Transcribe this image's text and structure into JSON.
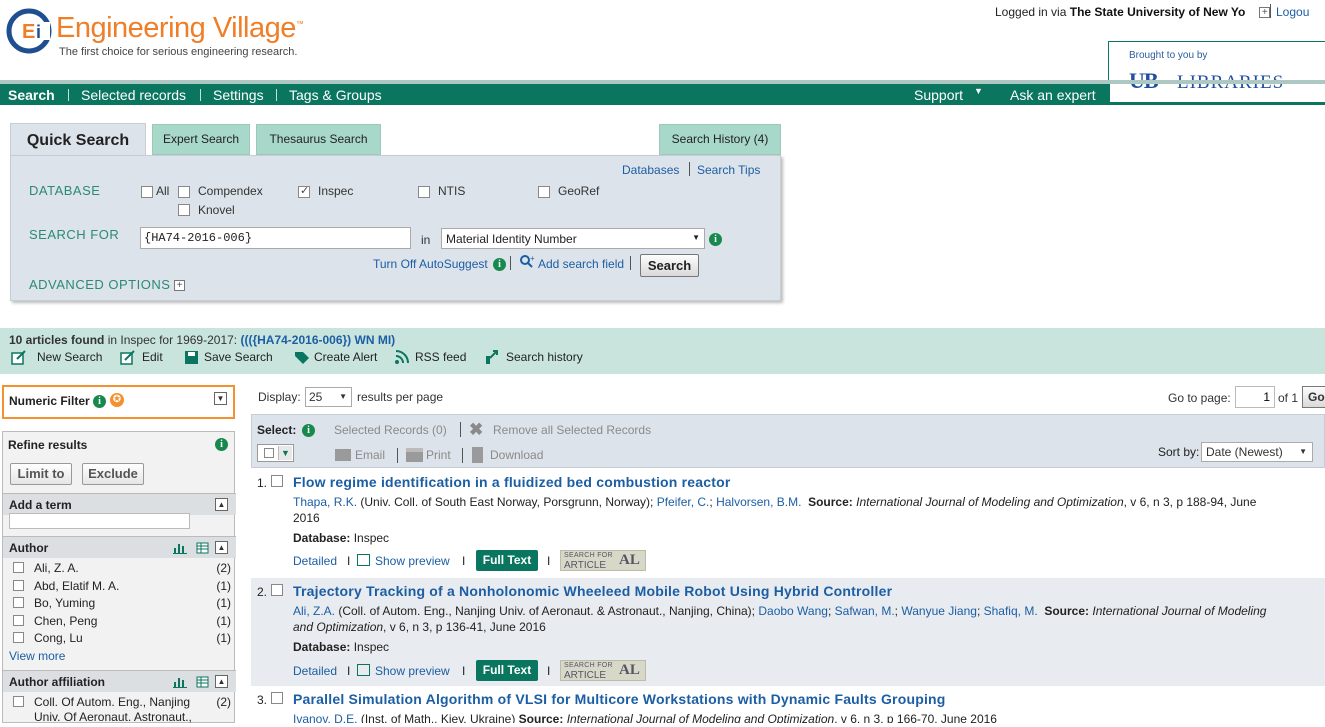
{
  "header": {
    "logo_title": "Engineering Village",
    "logo_tm": "™",
    "logo_tagline": "The first choice for serious engineering research.",
    "login_prefix": "Logged in via",
    "login_institution": "The State University of New Yo",
    "logout": "Logou",
    "brought_by": "Brought to you by",
    "library_logo": "UB",
    "library_name": "LIBRARIES"
  },
  "nav": {
    "search": "Search",
    "selected_records": "Selected records",
    "settings": "Settings",
    "tags_groups": "Tags & Groups",
    "support": "Support",
    "ask_expert": "Ask an expert"
  },
  "search_tabs": {
    "quick": "Quick Search",
    "expert": "Expert Search",
    "thesaurus": "Thesaurus Search",
    "history": "Search History (4)"
  },
  "search_panel": {
    "databases_link": "Databases",
    "search_tips_link": "Search Tips",
    "database_label": "DATABASE",
    "db_all": "All",
    "db_compendex": "Compendex",
    "db_inspec": "Inspec",
    "db_ntis": "NTIS",
    "db_georef": "GeoRef",
    "db_knovel": "Knovel",
    "search_for_label": "SEARCH FOR",
    "search_value": "{HA74-2016-006}",
    "in_label": "in",
    "field_value": "Material Identity Number",
    "autosuggest": "Turn Off AutoSuggest",
    "add_field": "Add search field",
    "search_button": "Search",
    "advanced": "ADVANCED OPTIONS"
  },
  "results_header": {
    "count": "10 articles found",
    "in_text": " in Inspec for 1969-2017: ",
    "query": "((({HA74-2016-006}) WN MI)",
    "tools": {
      "new_search": "New Search",
      "edit": "Edit",
      "save_search": "Save Search",
      "create_alert": "Create Alert",
      "rss": "RSS feed",
      "history": "Search history"
    }
  },
  "sidebar": {
    "numeric_filter": "Numeric Filter",
    "refine": "Refine results",
    "limit_to": "Limit to",
    "exclude": "Exclude",
    "add_term": "Add a term",
    "author_head": "Author",
    "authors": [
      {
        "name": "Ali, Z. A.",
        "count": "(2)"
      },
      {
        "name": "Abd, Elatif M. A.",
        "count": "(1)"
      },
      {
        "name": "Bo, Yuming",
        "count": "(1)"
      },
      {
        "name": "Chen, Peng",
        "count": "(1)"
      },
      {
        "name": "Cong, Lu",
        "count": "(1)"
      }
    ],
    "view_more": "View more",
    "affiliation_head": "Author affiliation",
    "affiliation_1_line1": "Coll. Of Autom. Eng., Nanjing",
    "affiliation_1_line2": "Univ. Of Aeronaut. Astronaut.,",
    "affiliation_1_count": "(2)"
  },
  "results": {
    "display_label": "Display:",
    "display_value": "25",
    "rpp_label": "results per page",
    "goto_label": "Go to page:",
    "goto_value": "1",
    "of_label": "of 1",
    "go_button": "Go",
    "select_label": "Select:",
    "selected_records": "Selected Records (0)",
    "remove_all": "Remove all Selected Records",
    "email": "Email",
    "print": "Print",
    "download": "Download",
    "sort_label": "Sort by:",
    "sort_value": "Date (Newest)",
    "detailed": "Detailed",
    "show_preview": "Show preview",
    "full_text": "Full Text",
    "sfa_top": "SEARCH FOR",
    "sfa_bottom": "ARTICLE",
    "sfa_mark": "AL",
    "items": [
      {
        "num": "1.",
        "title": "Flow regime identification in a fluidized bed combustion reactor",
        "author1": "Thapa, R.K.",
        "aff1": " (Univ. Coll. of South East Norway, Porsgrunn, Norway); ",
        "author2": "Pfeifer, C.",
        "sep": "; ",
        "author3": "Halvorsen, B.M.",
        "source_label": "Source:",
        "journal": "International Journal of Modeling and Optimization",
        "source_rest": ", v 6, n 3, p 188-94, June 2016",
        "db_label": "Database:",
        "db_value": "Inspec"
      },
      {
        "num": "2.",
        "title": "Trajectory Tracking of a Nonholonomic Wheeleed Mobile Robot Using Hybrid Controller",
        "author1": "Ali, Z.A.",
        "aff1": " (Coll. of Autom. Eng., Nanjing Univ. of Aeronaut. & Astronaut., Nanjing, China); ",
        "author2": "Daobo Wang",
        "author3": "Safwan, M.",
        "author4": "Wanyue Jiang",
        "author5": "Shafiq, M.",
        "source_label": "Source:",
        "journal": "International Journal of Modeling and Optimization",
        "source_rest": ", v 6, n 3, p 136-41, June 2016",
        "db_label": "Database:",
        "db_value": "Inspec"
      },
      {
        "num": "3.",
        "title": "Parallel Simulation Algorithm of VLSI for Multicore Workstations with Dynamic Faults Grouping",
        "author1": "Ivanov, D.E.",
        "aff1": " (Inst. of Math., Kiev, Ukraine) ",
        "source_label": "Source:",
        "journal": "International Journal of Modeling and Optimization",
        "source_rest": ", v 6, n 3, p 166-70, June 2016"
      }
    ]
  },
  "colors": {
    "brand_green": "#0b7660",
    "accent_orange": "#f07e26",
    "link_blue": "#1c5ea4",
    "panel_gray": "#dde3ea",
    "results_bar": "#c9e4dd"
  }
}
